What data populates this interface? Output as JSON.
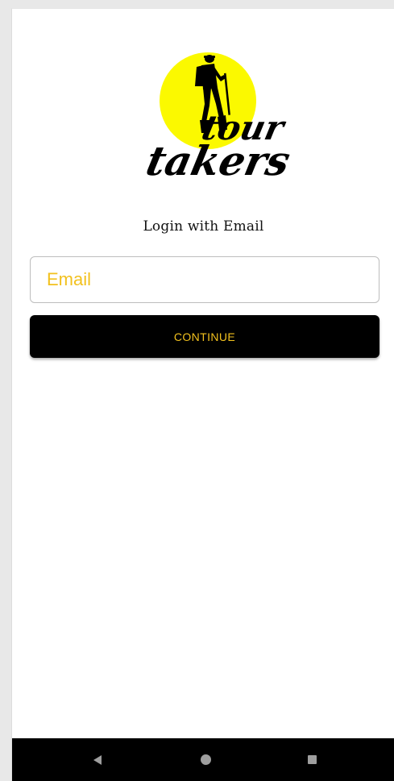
{
  "logo": {
    "line1": "tour",
    "line2": "takers",
    "sun_color": "#fbf900",
    "ink_color": "#000000"
  },
  "login": {
    "title": "Login with Email",
    "email_placeholder": "Email",
    "email_value": "",
    "continue_label": "CONTINUE"
  },
  "colors": {
    "accent": "#f2c11e",
    "button_bg": "#000000",
    "navbar_bg": "#000000"
  },
  "navbar": {
    "icons": [
      "back-icon",
      "home-icon",
      "recents-icon"
    ]
  }
}
